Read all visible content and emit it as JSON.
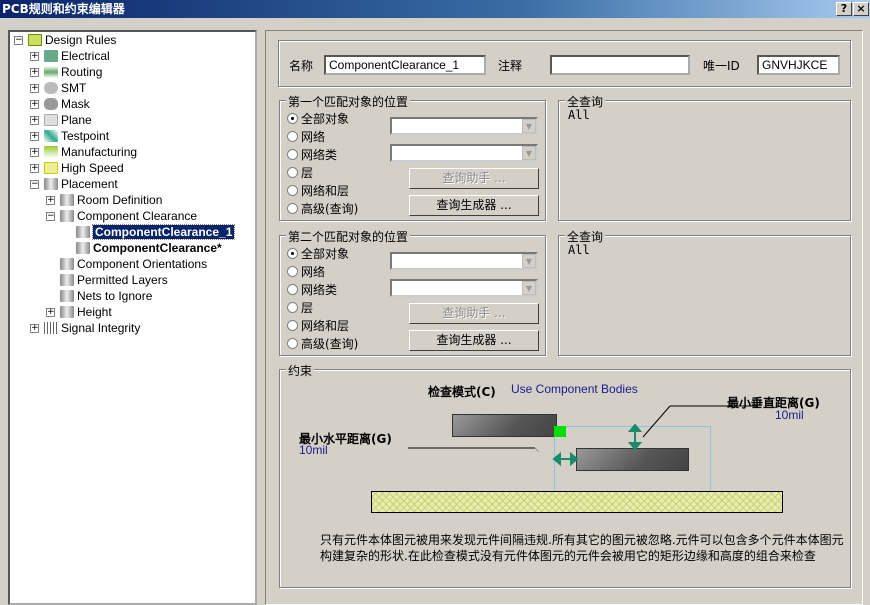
{
  "window": {
    "title": "PCB规则和约束编辑器",
    "help": "?",
    "close": "×"
  },
  "tree": {
    "root": "Design Rules",
    "items": [
      "Electrical",
      "Routing",
      "SMT",
      "Mask",
      "Plane",
      "Testpoint",
      "Manufacturing",
      "High Speed",
      "Placement"
    ],
    "placement_children": [
      "Room Definition",
      "Component Clearance",
      "Component Orientations",
      "Permitted Layers",
      "Nets to Ignore",
      "Height"
    ],
    "clearance_children": [
      "ComponentClearance_1",
      "ComponentClearance*"
    ],
    "last": "Signal Integrity"
  },
  "header": {
    "name_label": "名称",
    "name_value": "ComponentClearance_1",
    "comment_label": "注释",
    "comment_value": "",
    "id_label": "唯一ID",
    "id_value": "GNVHJKCE"
  },
  "first": {
    "title": "第一个匹配对象的位置",
    "options": [
      "全部对象",
      "网络",
      "网络类",
      "层",
      "网络和层",
      "高级(查询)"
    ],
    "selected": 0,
    "helper": "查询助手 ...",
    "builder": "查询生成器 ...",
    "query_title": "全查询",
    "query": "All"
  },
  "second": {
    "title": "第二个匹配对象的位置",
    "options": [
      "全部对象",
      "网络",
      "网络类",
      "层",
      "网络和层",
      "高级(查询)"
    ],
    "selected": 0,
    "helper": "查询助手 ...",
    "builder": "查询生成器 ...",
    "query_title": "全查询",
    "query": "All"
  },
  "constraints": {
    "title": "约束",
    "mode_label": "检查模式(C)",
    "mode_value": "Use Component Bodies",
    "h_label": "最小水平距离(G)",
    "h_value": "10mil",
    "v_label": "最小垂直距离(G)",
    "v_value": "10mil",
    "desc1": "只有元件本体图元被用来发现元件间隔违规.所有其它的图元被忽略.元件可以包含多个元件本体图元",
    "desc2": "构建复杂的形状.在此检查模式没有元件体图元的元件会被用它的矩形边缘和高度的组合来检查"
  }
}
